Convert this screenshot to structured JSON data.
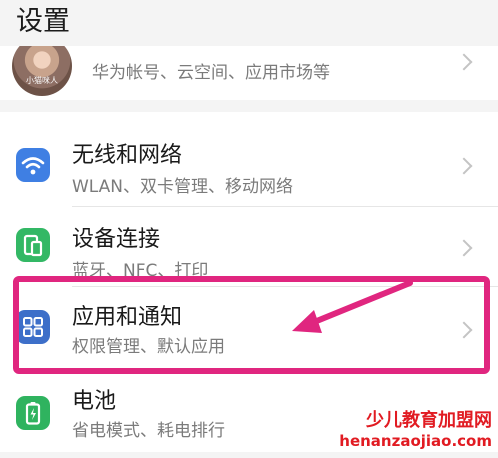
{
  "header": {
    "title": "设置"
  },
  "account": {
    "name_partial": "帐号",
    "subtitle": "华为帐号、云空间、应用市场等",
    "avatar_caption": "小猫咪人"
  },
  "settings": {
    "items": [
      {
        "title": "无线和网络",
        "subtitle": "WLAN、双卡管理、移动网络",
        "icon": "wifi-icon",
        "color": "#3f7fe3"
      },
      {
        "title": "设备连接",
        "subtitle": "蓝牙、NFC、打印",
        "icon": "device-connection-icon",
        "color": "#33b865"
      },
      {
        "title": "应用和通知",
        "subtitle": "权限管理、默认应用",
        "icon": "apps-grid-icon",
        "color": "#3d6fc9"
      },
      {
        "title": "电池",
        "subtitle": "省电模式、耗电排行",
        "icon": "battery-icon",
        "color": "#2fb35f"
      }
    ]
  },
  "annotation": {
    "highlight_color": "#e0267f"
  },
  "watermark": {
    "line1": "少儿教育加盟网",
    "line2": "henanzaojiao.com"
  }
}
